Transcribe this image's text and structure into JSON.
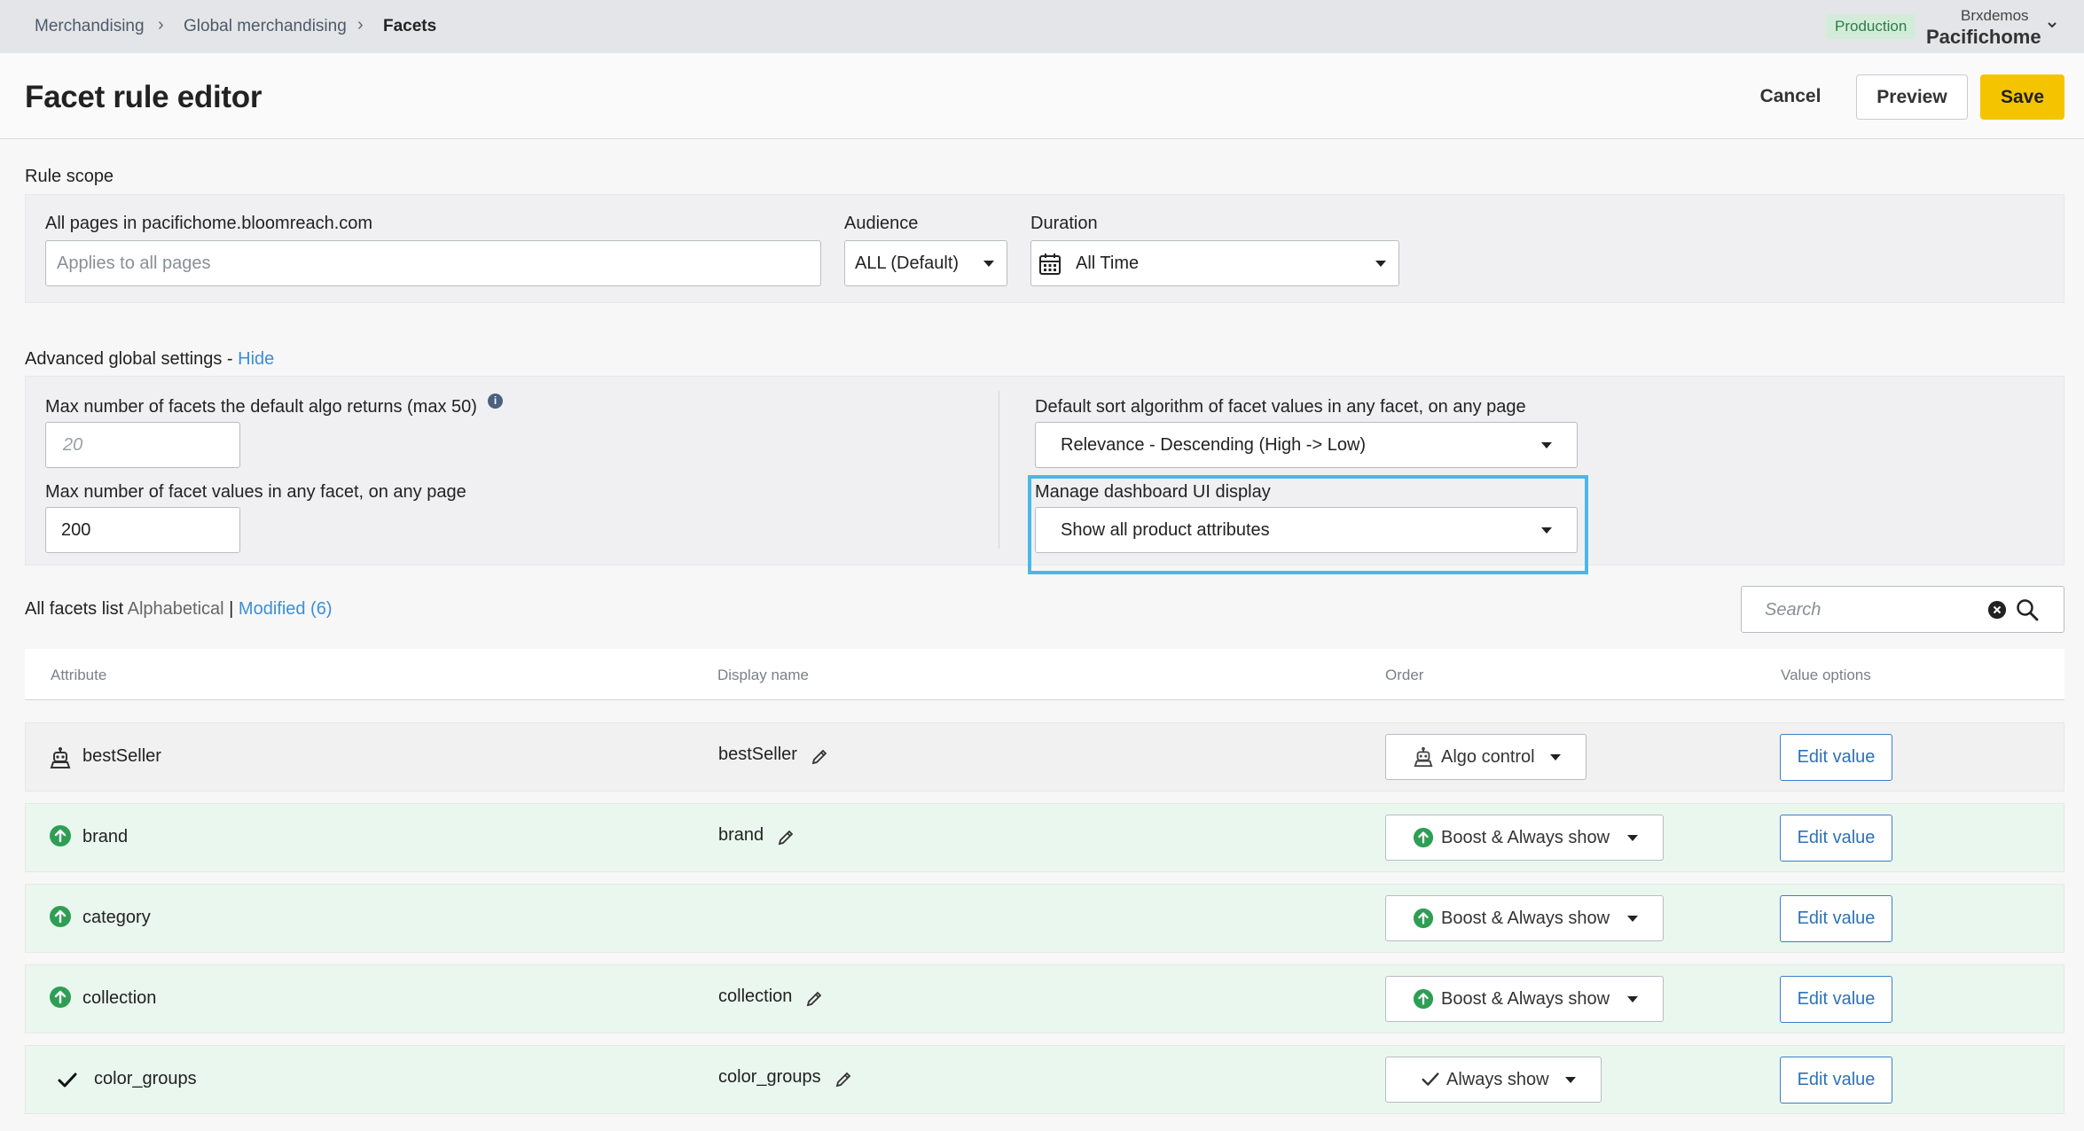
{
  "breadcrumb": {
    "items": [
      "Merchandising",
      "Global merchandising",
      "Facets"
    ]
  },
  "account": {
    "environment": "Production",
    "org": "Brxdemos",
    "site": "Pacifichome"
  },
  "header": {
    "title": "Facet rule editor",
    "cancel_label": "Cancel",
    "preview_label": "Preview",
    "save_label": "Save"
  },
  "rule_scope": {
    "title": "Rule scope",
    "pages_label": "All pages in pacifichome.bloomreach.com",
    "pages_placeholder": "Applies to all pages",
    "audience_label": "Audience",
    "audience_value": "ALL (Default)",
    "duration_label": "Duration",
    "duration_value": "All Time"
  },
  "advanced": {
    "title": "Advanced global settings - ",
    "toggle_label": "Hide",
    "max_facets_label": "Max number of facets the default algo returns (max 50)",
    "max_facets_placeholder": "20",
    "max_values_label": "Max number of facet values in any facet, on any page",
    "max_values_value": "200",
    "sort_label": "Default sort algorithm of facet values in any facet, on any page",
    "sort_value": "Relevance - Descending (High -> Low)",
    "display_label": "Manage dashboard UI display",
    "display_value": "Show all product attributes"
  },
  "facets_list": {
    "title": "All facets list",
    "sort_alpha": "Alphabetical",
    "separator": "|",
    "sort_modified": "Modified (6)",
    "search_placeholder": "Search",
    "columns": [
      "Attribute",
      "Display name",
      "Order",
      "Value options"
    ],
    "rows": [
      {
        "attribute": "bestSeller",
        "display_name": "bestSeller",
        "order": "Algo control",
        "order_icon": "robot-icon",
        "value_action": "Edit value"
      },
      {
        "attribute": "brand",
        "display_name": "brand",
        "order": "Boost & Always show",
        "order_icon": "boost-up-icon",
        "value_action": "Edit value"
      },
      {
        "attribute": "category",
        "display_name": "",
        "order": "Boost & Always show",
        "order_icon": "boost-up-icon",
        "value_action": "Edit value"
      },
      {
        "attribute": "collection",
        "display_name": "collection",
        "order": "Boost & Always show",
        "order_icon": "boost-up-icon",
        "value_action": "Edit value"
      },
      {
        "attribute": "color_groups",
        "display_name": "color_groups",
        "order": "Always show",
        "order_icon": "check-icon",
        "value_action": "Edit value"
      }
    ]
  },
  "colors": {
    "accent": "#f5c400",
    "link": "#3b8fd6",
    "boost_green": "#2f9e55",
    "highlight": "#4db6e8"
  }
}
